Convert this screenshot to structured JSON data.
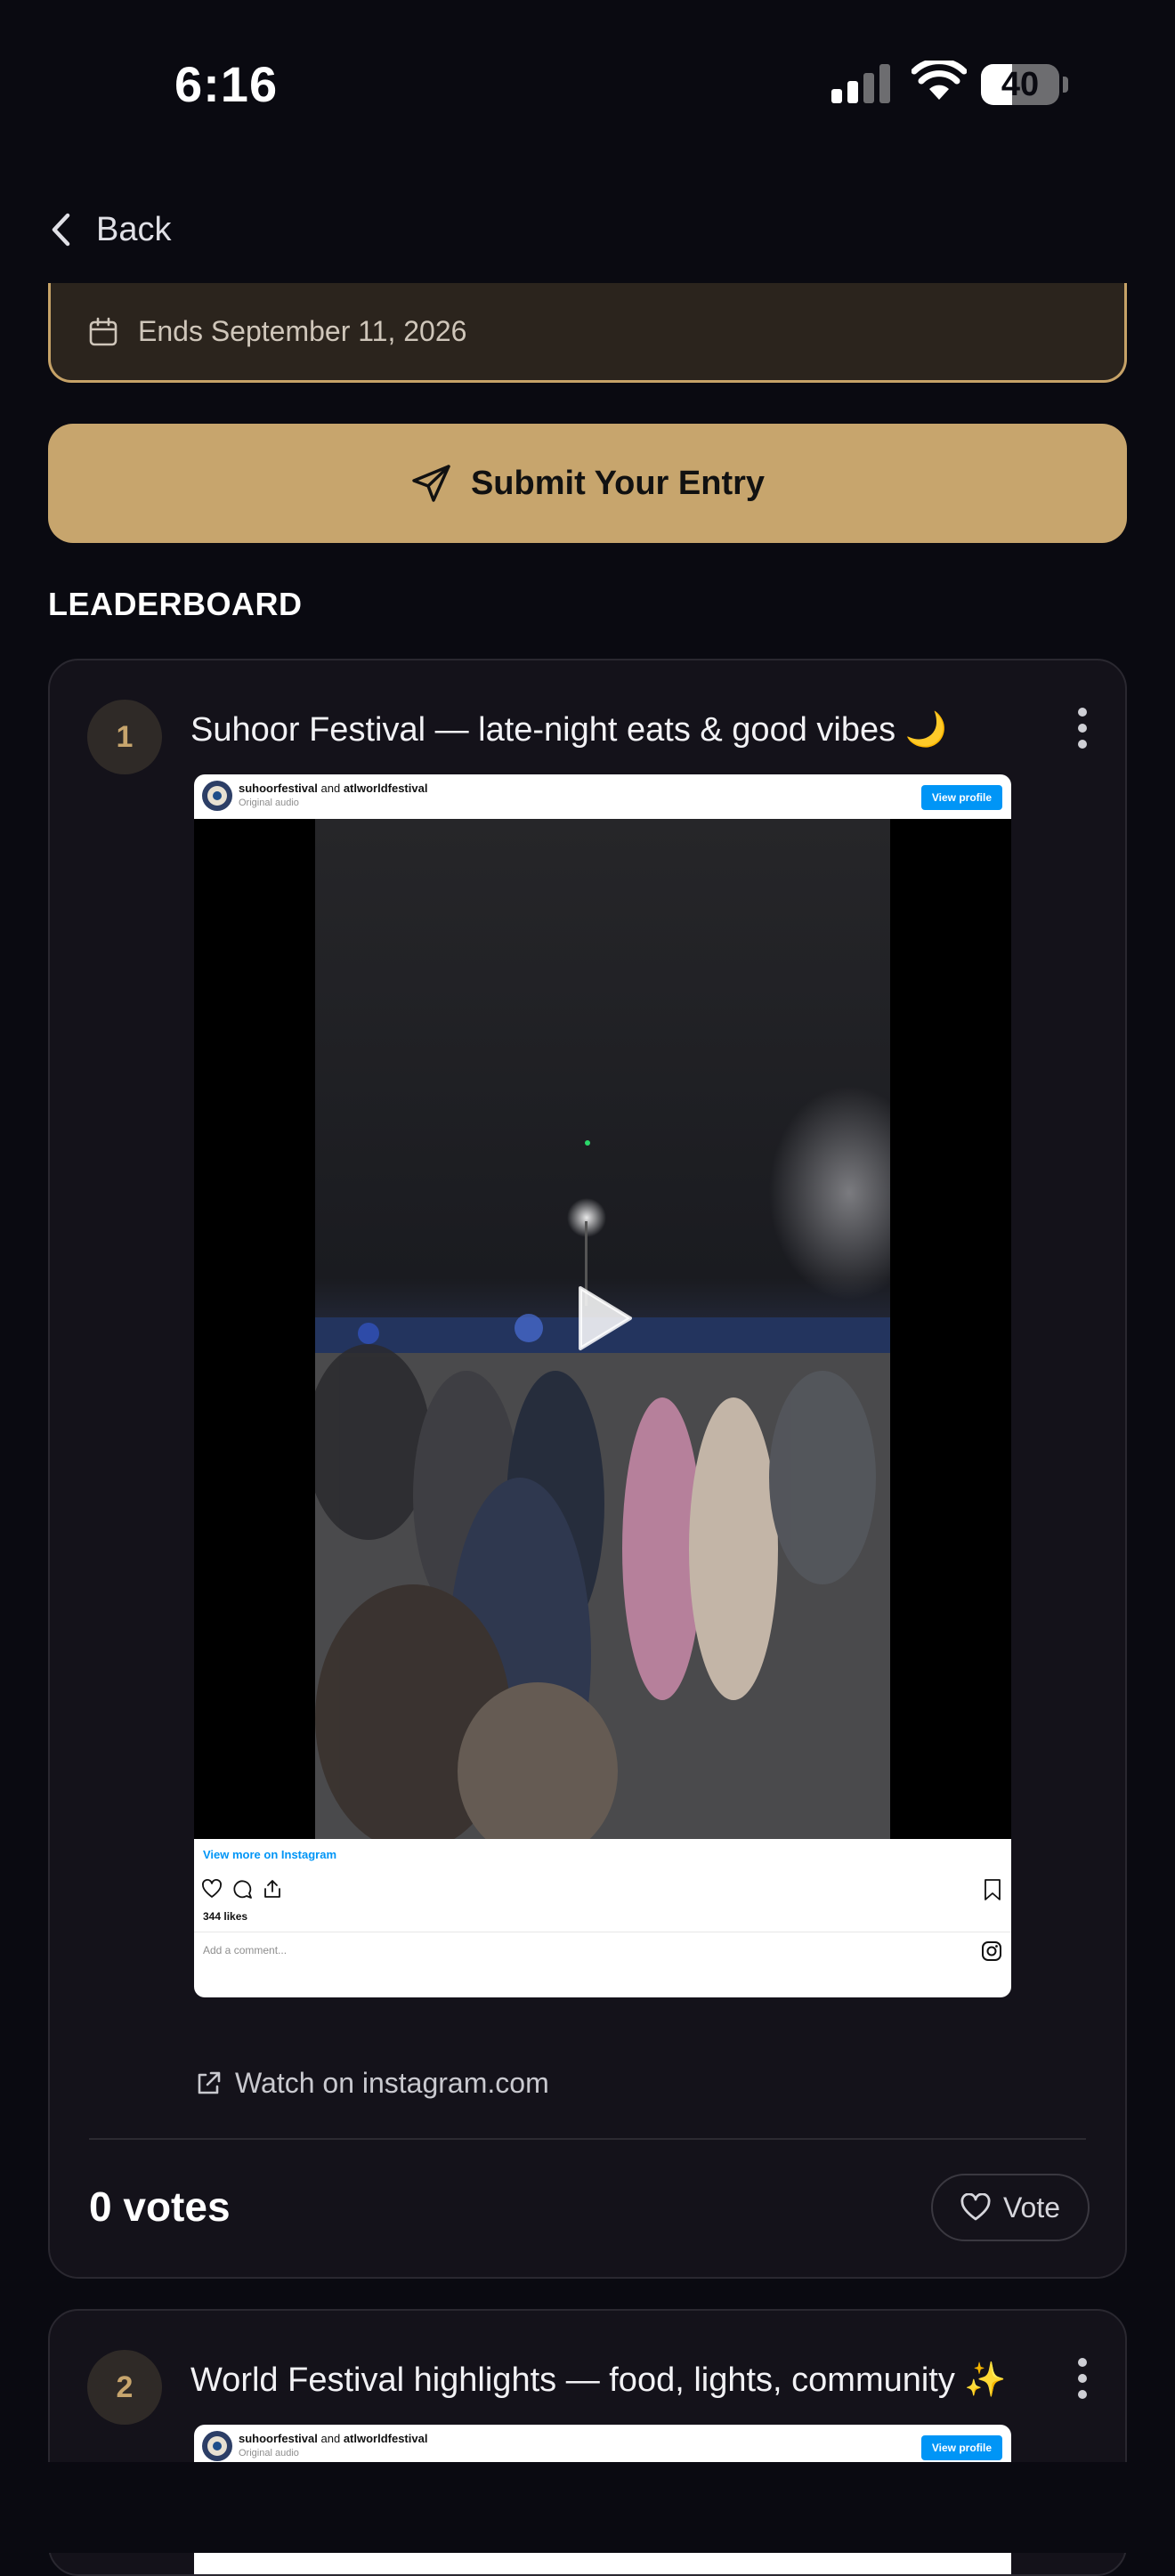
{
  "status_bar": {
    "time": "6:16",
    "battery": "40",
    "battery_level": 0.4
  },
  "nav": {
    "back_label": "Back"
  },
  "challenge": {
    "ends_label": "Ends September 11, 2026"
  },
  "submit": {
    "label": "Submit Your Entry"
  },
  "leaderboard": {
    "heading": "LEADERBOARD",
    "entries": [
      {
        "rank": "1",
        "title": "Suhoor Festival — late-night eats & good vibes 🌙",
        "embed": {
          "author": "suhoorfestival",
          "joiner": "and",
          "coauthor": "atlworldfestival",
          "audio": "Original audio",
          "view_profile": "View profile",
          "view_more": "View more on Instagram",
          "likes": "344 likes",
          "comment_placeholder": "Add a comment..."
        },
        "watch_label": "Watch on instagram.com",
        "votes": "0 votes",
        "vote_label": "Vote"
      },
      {
        "rank": "2",
        "title": "World Festival highlights — food, lights, community ✨",
        "embed": {
          "author": "suhoorfestival",
          "joiner": "and",
          "coauthor": "atlworldfestival",
          "audio": "Original audio",
          "view_profile": "View profile"
        }
      }
    ]
  },
  "colors": {
    "accent": "#c7a56d",
    "background": "#0a0a11",
    "card": "#14121a",
    "ig_blue": "#0095f6"
  },
  "icons": [
    "back-chevron-icon",
    "calendar-icon",
    "send-icon",
    "more-vertical-icon",
    "play-icon",
    "heart-icon",
    "comment-icon",
    "share-icon",
    "bookmark-icon",
    "instagram-icon",
    "external-link-icon"
  ]
}
